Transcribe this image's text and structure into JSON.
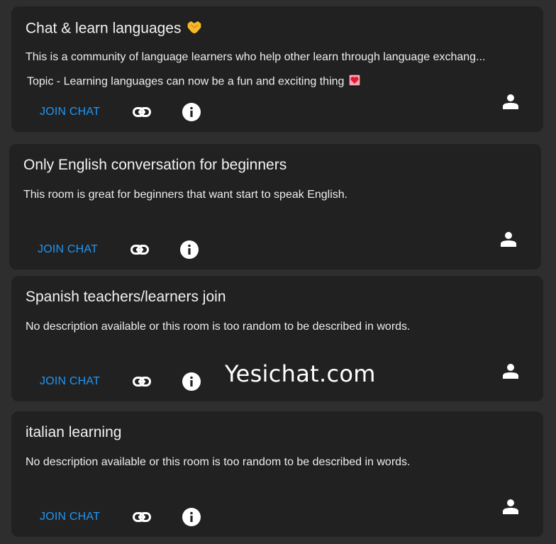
{
  "colors": {
    "page_background": "#2e2e2e",
    "card_background": "#212121",
    "accent": "#2196f3",
    "text": "#ffffff"
  },
  "rooms": [
    {
      "title": "Chat & learn languages",
      "title_emoji": "handshake-emoji",
      "description": "This is a community of language learners who help other learn through language exchang...",
      "topic": "Topic - Learning languages can now be a fun and exciting thing",
      "topic_emoji": "heart-decoration-emoji",
      "join_label": "JOIN CHAT",
      "link_icon": "link-icon",
      "info_icon": "info-icon",
      "user_icon": "person-icon"
    },
    {
      "title": "Only English conversation for beginners",
      "description": "This room is great for beginners that want start to speak English.",
      "join_label": "JOIN CHAT",
      "link_icon": "link-icon",
      "info_icon": "info-icon",
      "user_icon": "person-icon"
    },
    {
      "title": "Spanish teachers/learners join",
      "description": "No description available or this room is too random to be described in words.",
      "join_label": "JOIN CHAT",
      "link_icon": "link-icon",
      "info_icon": "info-icon",
      "user_icon": "person-icon"
    },
    {
      "title": "italian learning",
      "description": "No description available or this room is too random to be described in words.",
      "join_label": "JOIN CHAT",
      "link_icon": "link-icon",
      "info_icon": "info-icon",
      "user_icon": "person-icon"
    }
  ],
  "watermark": "Yesichat.com"
}
